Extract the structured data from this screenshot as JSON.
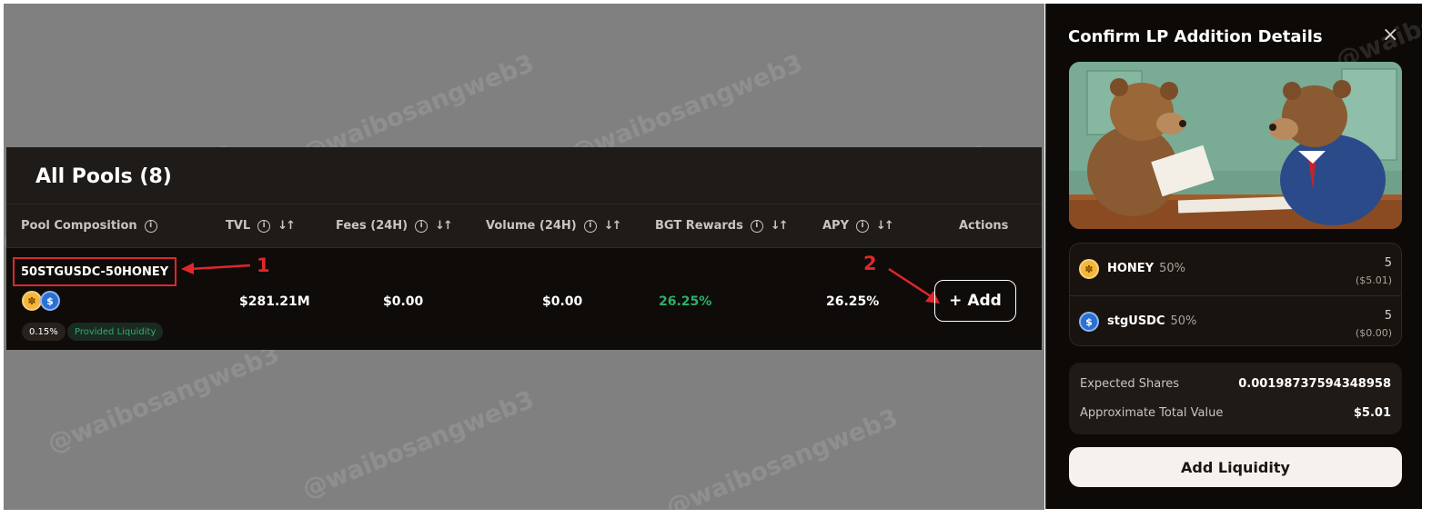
{
  "pools": {
    "title": "All Pools (8)",
    "columns": {
      "composition": "Pool Composition",
      "tvl": "TVL",
      "fees": "Fees (24H)",
      "volume": "Volume (24H)",
      "bgt": "BGT Rewards",
      "apy": "APY",
      "actions": "Actions"
    },
    "row": {
      "name": "50STGUSDC-50HONEY",
      "fee_tag": "0.15%",
      "status_tag": "Provided Liquidity",
      "tvl": "$281.21M",
      "fees": "$0.00",
      "volume": "$0.00",
      "bgt": "26.25%",
      "apy": "26.25%",
      "add_label": "+ Add"
    }
  },
  "annotations": {
    "marker_1": "1",
    "marker_2": "2",
    "color": "#e0262b"
  },
  "watermark": "@waibosangweb3",
  "modal": {
    "title": "Confirm LP Addition Details",
    "close_glyph": "×",
    "tokens": [
      {
        "name": "HONEY",
        "pct": "50%",
        "amount": "5",
        "usd": "($5.01)",
        "icon": "honey-token-icon"
      },
      {
        "name": "stgUSDC",
        "pct": "50%",
        "amount": "5",
        "usd": "($0.00)",
        "icon": "usdc-token-icon"
      }
    ],
    "expected_shares_label": "Expected Shares",
    "expected_shares_value": "0.00198737594348958",
    "total_value_label": "Approximate Total Value",
    "total_value": "$5.01",
    "add_liquidity_label": "Add Liquidity"
  },
  "colors": {
    "positive": "#28b26a",
    "honey": "#f5b73b",
    "usdc": "#2a6fd6"
  }
}
